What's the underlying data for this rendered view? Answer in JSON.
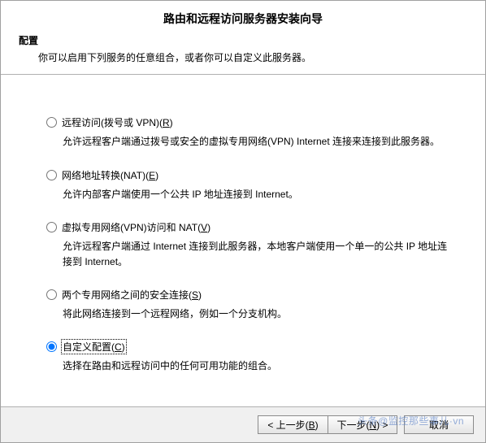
{
  "title": "路由和远程访问服务器安装向导",
  "subheader": {
    "heading": "配置",
    "desc": "你可以启用下列服务的任意组合，或者你可以自定义此服务器。"
  },
  "options": [
    {
      "id": "remote-access",
      "label_pre": "远程访问(拨号或 VPN)(",
      "label_key": "R",
      "label_post": ")",
      "desc": "允许远程客户端通过拨号或安全的虚拟专用网络(VPN) Internet 连接来连接到此服务器。",
      "checked": false
    },
    {
      "id": "nat",
      "label_pre": "网络地址转换(NAT)(",
      "label_key": "E",
      "label_post": ")",
      "desc": "允许内部客户端使用一个公共 IP 地址连接到 Internet。",
      "checked": false
    },
    {
      "id": "vpn-nat",
      "label_pre": "虚拟专用网络(VPN)访问和 NAT(",
      "label_key": "V",
      "label_post": ")",
      "desc": "允许远程客户端通过 Internet 连接到此服务器，本地客户端使用一个单一的公共 IP 地址连接到 Internet。",
      "checked": false
    },
    {
      "id": "secure-two-net",
      "label_pre": "两个专用网络之间的安全连接(",
      "label_key": "S",
      "label_post": ")",
      "desc": "将此网络连接到一个远程网络，例如一个分支机构。",
      "checked": false
    },
    {
      "id": "custom",
      "label_pre": "自定义配置(",
      "label_key": "C",
      "label_post": ")",
      "desc": "选择在路由和远程访问中的任何可用功能的组合。",
      "checked": true
    }
  ],
  "buttons": {
    "back_pre": "< 上一步(",
    "back_key": "B",
    "back_post": ")",
    "next_pre": "下一步(",
    "next_key": "N",
    "next_post": ") >",
    "cancel": "取消"
  },
  "watermark": "头条@监控那些事儿·vn"
}
